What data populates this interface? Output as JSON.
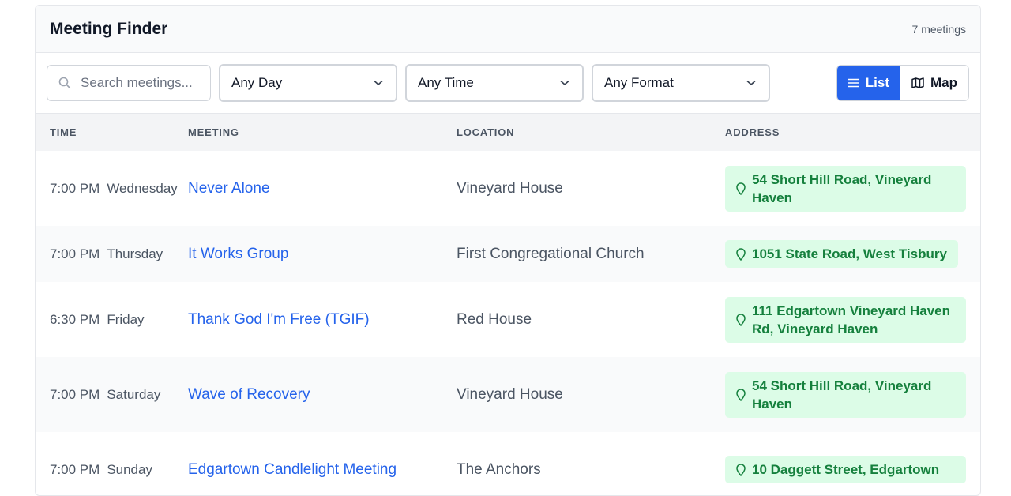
{
  "app": {
    "title": "Meeting Finder",
    "count": "7 meetings"
  },
  "filters": {
    "search_placeholder": "Search meetings...",
    "day": "Any Day",
    "time": "Any Time",
    "format": "Any Format"
  },
  "view": {
    "list_label": "List",
    "map_label": "Map",
    "active": "List"
  },
  "table": {
    "headers": {
      "time": "TIME",
      "meeting": "MEETING",
      "location": "LOCATION",
      "address": "ADDRESS"
    },
    "rows": [
      {
        "time": "7:00 PM",
        "day": "Wednesday",
        "meeting": "Never Alone",
        "location": "Vineyard House",
        "address": "54 Short Hill Road, Vineyard Haven"
      },
      {
        "time": "7:00 PM",
        "day": "Thursday",
        "meeting": "It Works Group",
        "location": "First Congregational Church",
        "address": "1051 State Road, West Tisbury"
      },
      {
        "time": "6:30 PM",
        "day": "Friday",
        "meeting": "Thank God I'm Free (TGIF)",
        "location": "Red House",
        "address": "111 Edgartown Vineyard Haven Rd, Vineyard Haven"
      },
      {
        "time": "7:00 PM",
        "day": "Saturday",
        "meeting": "Wave of Recovery",
        "location": "Vineyard House",
        "address": "54 Short Hill Road, Vineyard Haven"
      },
      {
        "time": "7:00 PM",
        "day": "Sunday",
        "meeting": "Edgartown Candlelight Meeting",
        "location": "The Anchors",
        "address": "10 Daggett Street, Edgartown"
      }
    ]
  },
  "colors": {
    "accent": "#2563eb",
    "address_bg": "#dcfce7",
    "address_text": "#15803d"
  }
}
